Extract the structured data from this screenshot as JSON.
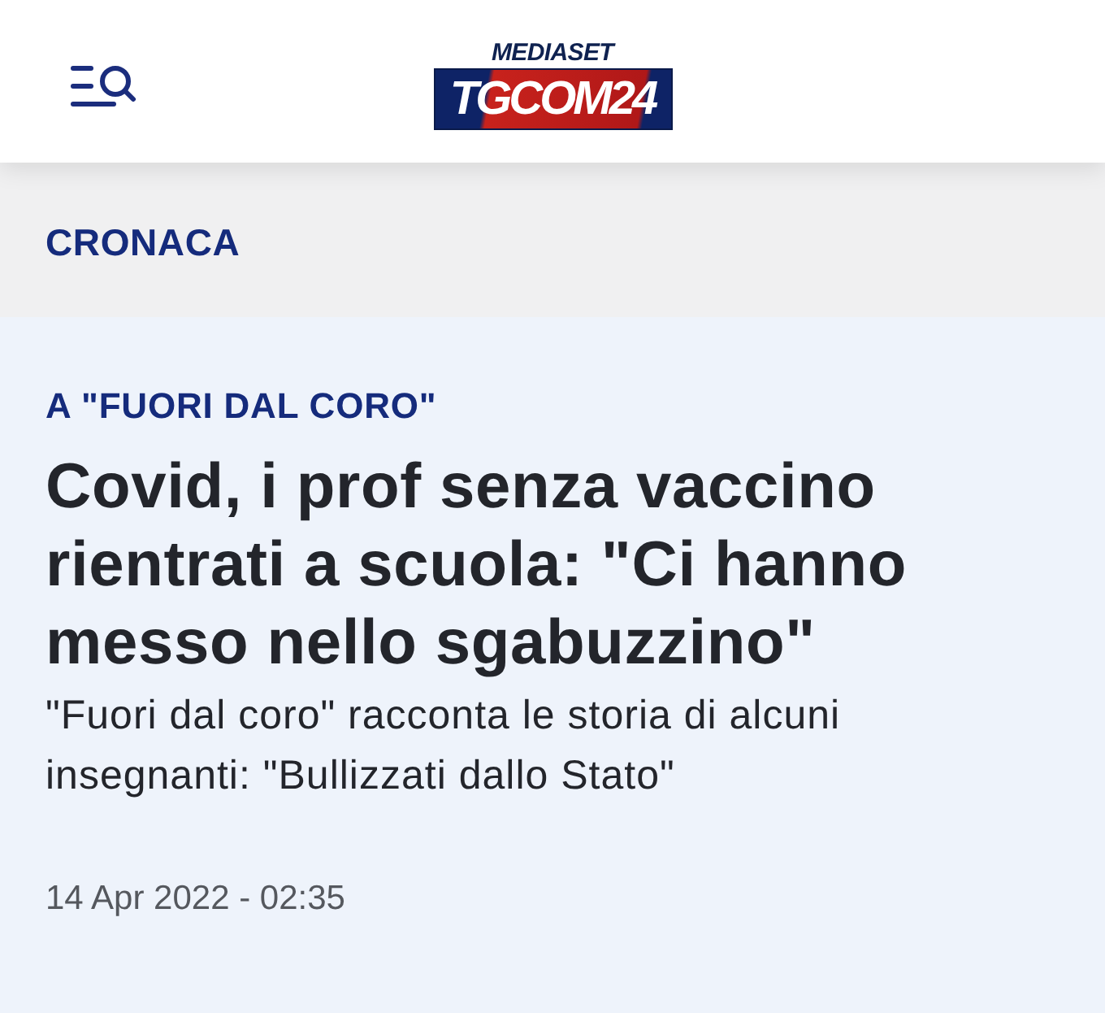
{
  "header": {
    "logo": {
      "brand": "MEDIASET",
      "name": "TGCOM24"
    }
  },
  "section": {
    "label": "CRONACA"
  },
  "article": {
    "kicker": "A \"FUORI DAL CORO\"",
    "headline": "Covid, i prof senza vaccino rientrati a scuola: \"Ci hanno messo nello sgabuzzino\"",
    "summary": "\"Fuori dal coro\" racconta le storia di alcuni insegnanti: \"Bullizzati dallo Stato\"",
    "date": "14 Apr 2022 - 02:35"
  }
}
